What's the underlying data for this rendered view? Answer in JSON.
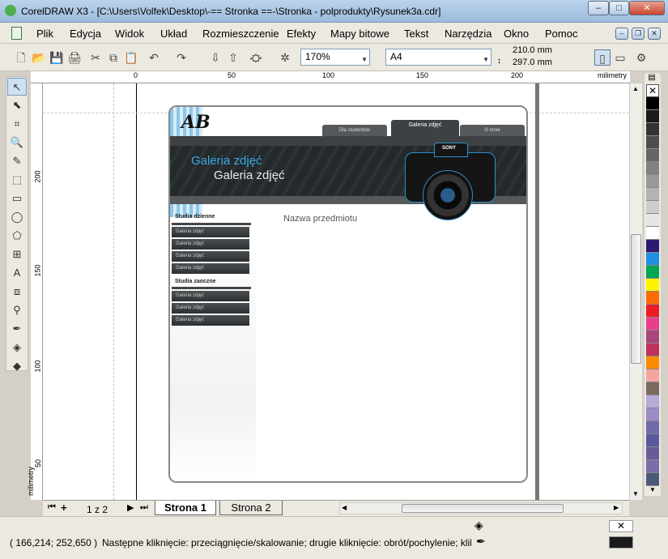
{
  "window": {
    "title": "CorelDRAW X3 - [C:\\Users\\Volfek\\Desktop\\-== Stronka ==-\\Stronka - polprodukty\\Rysunek3a.cdr]",
    "minimize": "–",
    "maximize": "□",
    "close": "✕"
  },
  "menu": [
    "Plik",
    "Edycja",
    "Widok",
    "Układ",
    "Rozmieszczenie",
    "Efekty",
    "Mapy bitowe",
    "Tekst",
    "Narzędzia",
    "Okno",
    "Pomoc"
  ],
  "toolbar": {
    "zoom": "170%",
    "page_size": "A4",
    "width": "210.0 mm",
    "height": "297.0 mm"
  },
  "ruler": {
    "unit": "milimetry",
    "h_ticks": [
      "0",
      "50",
      "100",
      "150",
      "200"
    ],
    "v_ticks": [
      "200",
      "150",
      "100",
      "50"
    ],
    "v_unit": "milimetry"
  },
  "mockup": {
    "logo": "AB",
    "tabs": [
      "Dla studentów",
      "Galeria zdjęć",
      "O mnie"
    ],
    "header_title1": "Galeria zdjęć",
    "header_title2": "Galeria zdjęć",
    "subject": "Nazwa przedmiotu",
    "camera_brand": "SONY",
    "section1": "Studia dzienne",
    "section1_items": [
      "Galeria zdjęć",
      "Galeria zdjęć",
      "Galeria zdjęć",
      "Galeria zdjęć"
    ],
    "section2": "Studia zaoczne",
    "section2_items": [
      "Galeria zdjęć",
      "Galeria zdjęć",
      "Galeria zdjęć"
    ]
  },
  "pagetabs": {
    "counter": "1 z 2",
    "page1": "Strona 1",
    "page2": "Strona 2"
  },
  "status": {
    "coords": "( 166,214; 252,650 )",
    "hint": "Następne kliknięcie: przeciągnięcie/skalowanie; drugie kliknięcie: obrót/pochylenie; kliknięcie ..."
  },
  "palette": [
    "#000000",
    "#1a1a1a",
    "#333333",
    "#4d4d4d",
    "#666666",
    "#808080",
    "#999999",
    "#b3b3b3",
    "#cccccc",
    "#e6e6e6",
    "#ffffff",
    "#2e1a6e",
    "#1e90e0",
    "#00a651",
    "#fff200",
    "#ff6a00",
    "#ed1c24",
    "#e83e8c",
    "#a8457a",
    "#c0305a",
    "#ff8c00",
    "#f5a5a0",
    "#7a6a5e",
    "#b7a9d8",
    "#9b8cc4",
    "#6e6aaa",
    "#5a58a0",
    "#6c5a98",
    "#7d6aa8",
    "#4c5a7a"
  ]
}
